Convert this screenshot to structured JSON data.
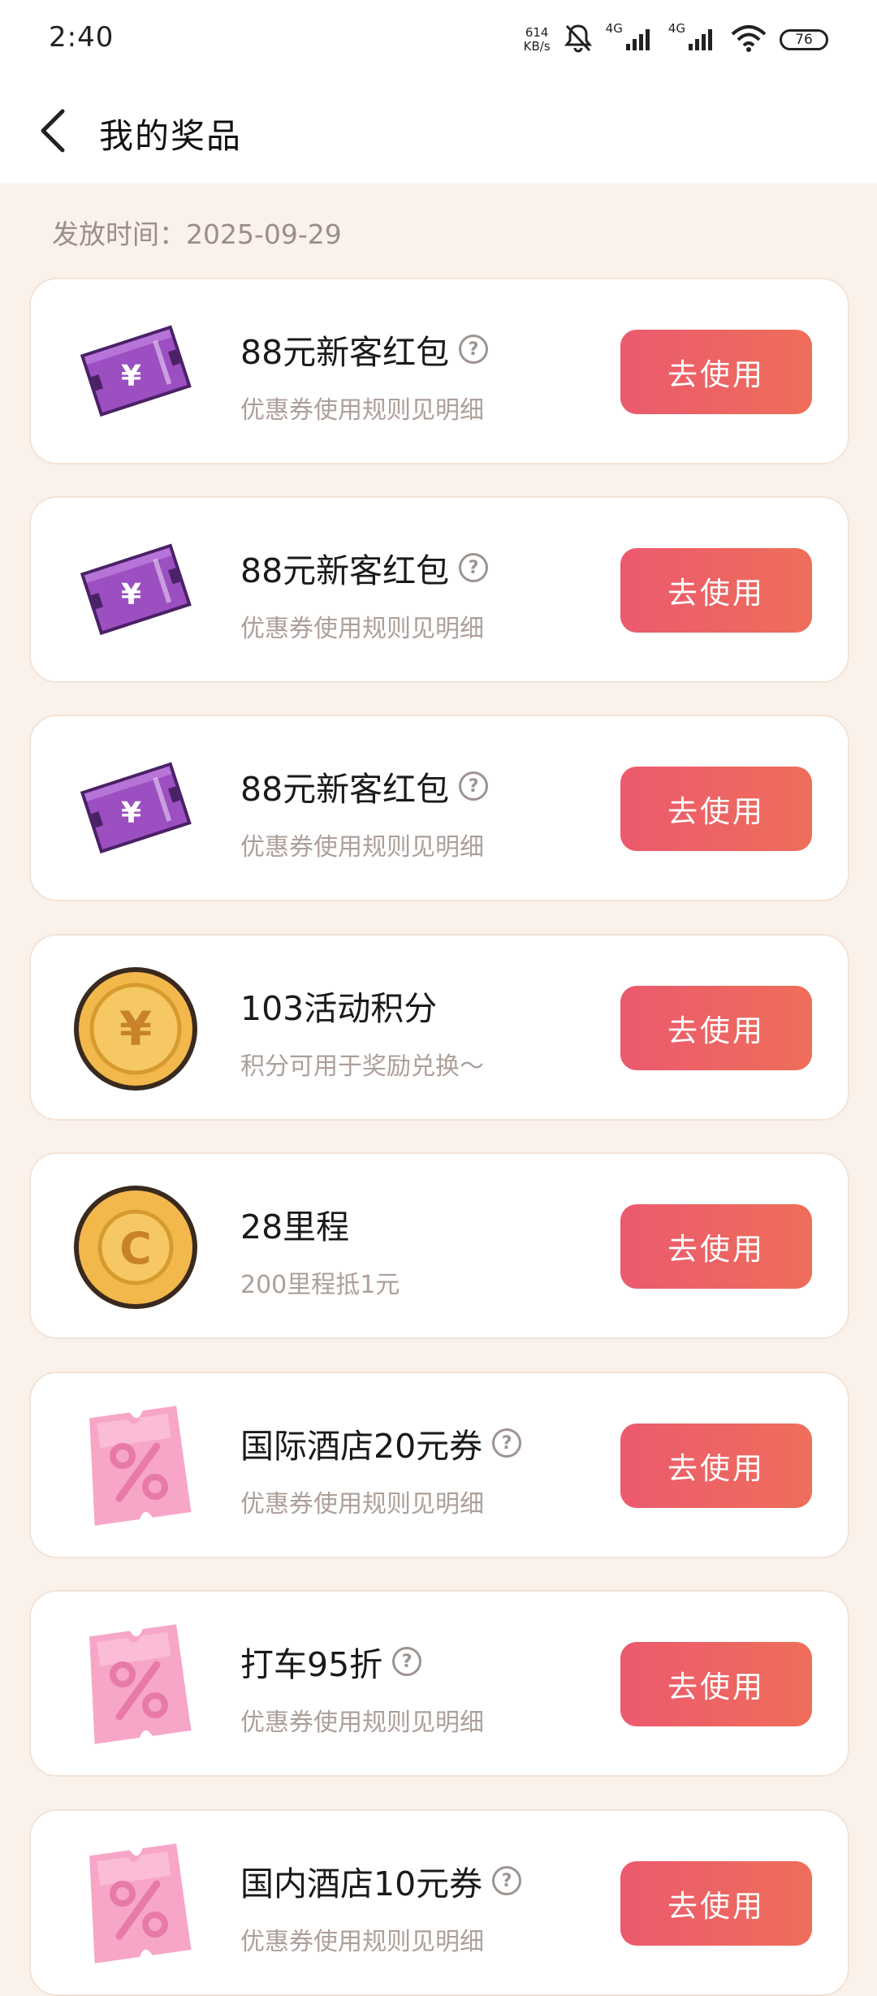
{
  "status": {
    "time": "2:40",
    "net_speed_value": "614",
    "net_speed_unit": "KB/s",
    "signal1_label": "4G",
    "signal2_label": "4G",
    "battery": "76"
  },
  "header": {
    "title": "我的奖品"
  },
  "issue_date": "发放时间：2025-09-29",
  "button_label": "去使用",
  "prizes": [
    {
      "title": "88元新客红包",
      "subtitle": "优惠券使用规则见明细",
      "icon": "purple-ticket-icon"
    },
    {
      "title": "88元新客红包",
      "subtitle": "优惠券使用规则见明细",
      "icon": "purple-ticket-icon"
    },
    {
      "title": "88元新客红包",
      "subtitle": "优惠券使用规则见明细",
      "icon": "purple-ticket-icon"
    },
    {
      "title": "103活动积分",
      "subtitle": "积分可用于奖励兑换～",
      "icon": "yen-coin-icon"
    },
    {
      "title": "28里程",
      "subtitle": "200里程抵1元",
      "icon": "c-coin-icon"
    },
    {
      "title": "国际酒店20元券",
      "subtitle": "优惠券使用规则见明细",
      "icon": "pink-coupon-icon"
    },
    {
      "title": "打车95折",
      "subtitle": "优惠券使用规则见明细",
      "icon": "pink-coupon-icon"
    },
    {
      "title": "国内酒店10元券",
      "subtitle": "优惠券使用规则见明细",
      "icon": "pink-coupon-icon"
    }
  ],
  "colors": {
    "background": "#fbf1eb",
    "button_start": "#ec5a6e",
    "button_end": "#ee6e5a",
    "ticket_purple": "#9b4fc0",
    "coin_gold": "#f2b84b",
    "coupon_pink": "#f7a6c8"
  }
}
